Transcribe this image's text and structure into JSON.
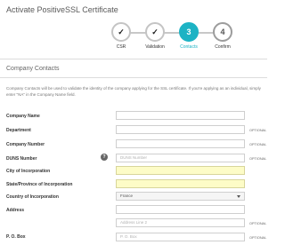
{
  "page": {
    "title": "Activate PositiveSSL Certificate"
  },
  "wizard": {
    "steps": [
      {
        "number": "",
        "label": "CSR",
        "state": "done"
      },
      {
        "number": "",
        "label": "Validation",
        "state": "done"
      },
      {
        "number": "3",
        "label": "Contacts",
        "state": "active"
      },
      {
        "number": "4",
        "label": "Confirm",
        "state": "pending"
      }
    ]
  },
  "section": {
    "title": "Company Contacts",
    "description": "Company Contacts will be used to validate the identity of the company applying for the SSL certificate. If you're applying as an individual, simply enter \"NA\" in the Company Name field."
  },
  "form": {
    "optional_label": "OPTIONAL",
    "company_name": {
      "label": "Company Name",
      "value": ""
    },
    "department": {
      "label": "Department",
      "value": ""
    },
    "company_number": {
      "label": "Company Number",
      "value": ""
    },
    "duns_number": {
      "label": "DUNS Number",
      "placeholder": "DUNS Number",
      "info_icon": "?"
    },
    "city_of_incorporation": {
      "label": "City of Incorporation",
      "value": ""
    },
    "state_of_incorporation": {
      "label": "State/Province of Incorporation",
      "value": ""
    },
    "country_of_incorporation": {
      "label": "Country of Incorporation",
      "value": "France"
    },
    "address": {
      "label": "Address",
      "value": ""
    },
    "address_line_2": {
      "placeholder": "Address Line 2"
    },
    "po_box": {
      "label": "P. O. Box",
      "placeholder": "P. O. Box"
    }
  }
}
